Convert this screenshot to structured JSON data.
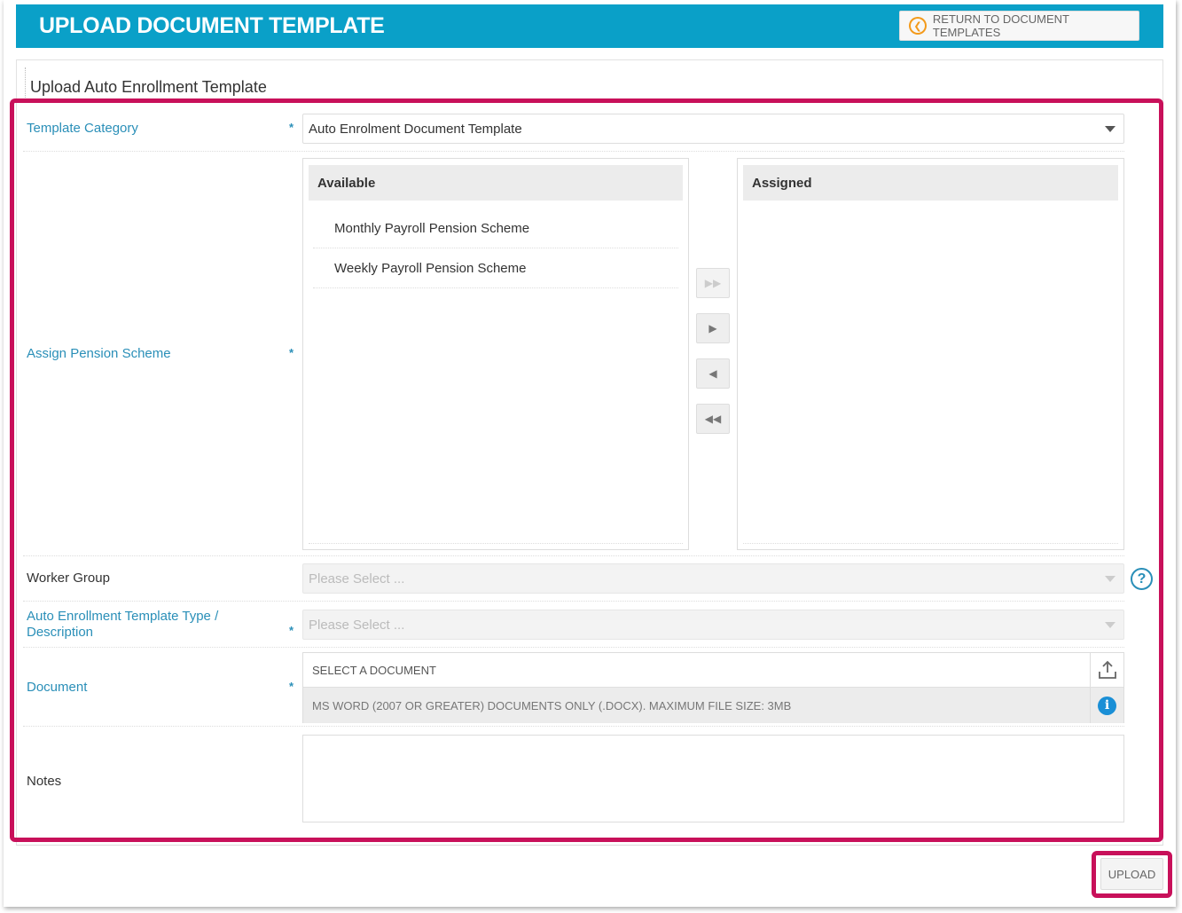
{
  "header": {
    "title": "UPLOAD DOCUMENT TEMPLATE",
    "return_label": "RETURN TO DOCUMENT TEMPLATES",
    "return_icon": "chevron-left-circle-icon"
  },
  "panel": {
    "title": "Upload Auto Enrollment Template"
  },
  "colors": {
    "header": "#0aa0c8",
    "accent": "#2a8fb8",
    "highlight": "#c8105a"
  },
  "form": {
    "required_marker": "*",
    "template_category": {
      "label": "Template Category",
      "value": "Auto Enrolment Document Template"
    },
    "assign_pension_scheme": {
      "label": "Assign Pension Scheme",
      "available_header": "Available",
      "assigned_header": "Assigned",
      "available_items": [
        "Monthly Payroll Pension Scheme",
        "Weekly Payroll Pension Scheme"
      ],
      "assigned_items": []
    },
    "worker_group": {
      "label": "Worker Group",
      "placeholder": "Please Select ...",
      "help": "?"
    },
    "template_type": {
      "label_line1": "Auto Enrollment Template Type /",
      "label_line2": "Description",
      "placeholder": "Please Select ..."
    },
    "document": {
      "label": "Document",
      "select_text": "SELECT A DOCUMENT",
      "hint": "MS WORD (2007 OR GREATER) DOCUMENTS ONLY (.DOCX). MAXIMUM FILE SIZE: 3MB",
      "info": "i"
    },
    "notes": {
      "label": "Notes",
      "value": ""
    }
  },
  "actions": {
    "upload_label": "UPLOAD"
  }
}
